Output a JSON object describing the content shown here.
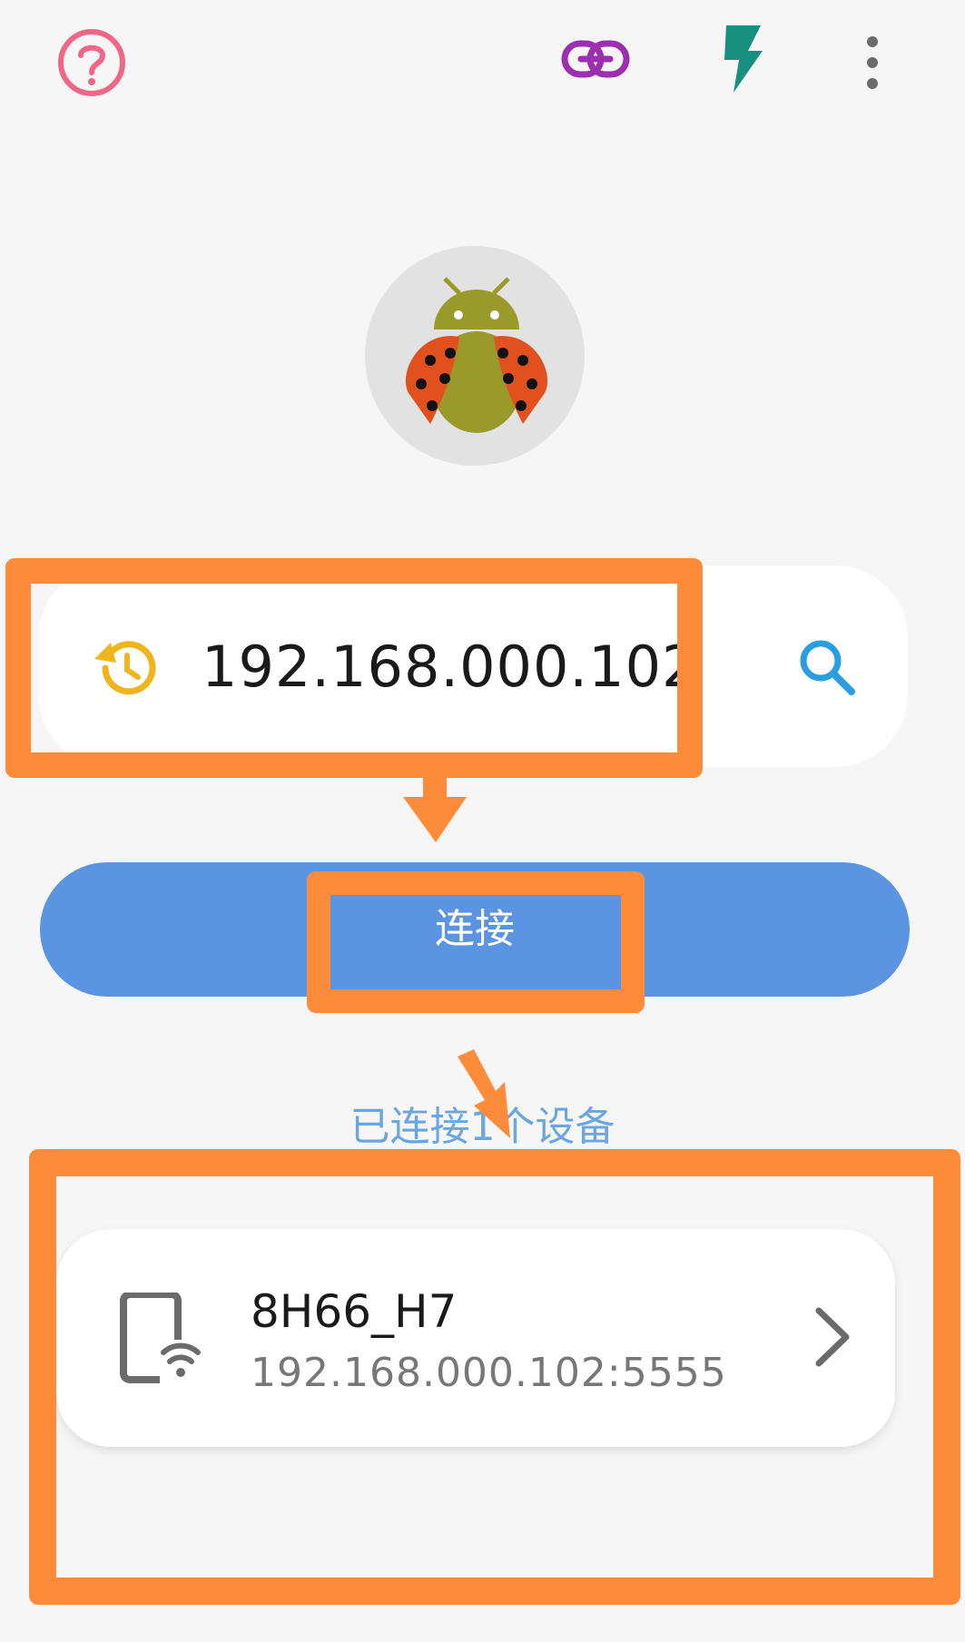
{
  "toolbar": {
    "help_icon": "help-circle-icon",
    "link_icon": "link-icon",
    "flash_icon": "flash-icon",
    "menu_icon": "more-vert-icon"
  },
  "logo": {
    "icon": "ladybug-android-icon"
  },
  "ip_input": {
    "history_icon": "history-icon",
    "value": "192.168.000.102",
    "search_icon": "search-icon"
  },
  "connect_button": {
    "label": "连接"
  },
  "devices": {
    "label": "已连接1个设备",
    "items": [
      {
        "name": "8H66_H7",
        "address": "192.168.000.102:5555",
        "icon": "phone-wifi-icon"
      }
    ]
  },
  "colors": {
    "accent": "#5b95e2",
    "annotation": "#fd8c3a",
    "help": "#ee6688",
    "link": "#9b2fb0",
    "flash": "#17907f",
    "history": "#f0b41c",
    "search": "#2a9ee0"
  }
}
